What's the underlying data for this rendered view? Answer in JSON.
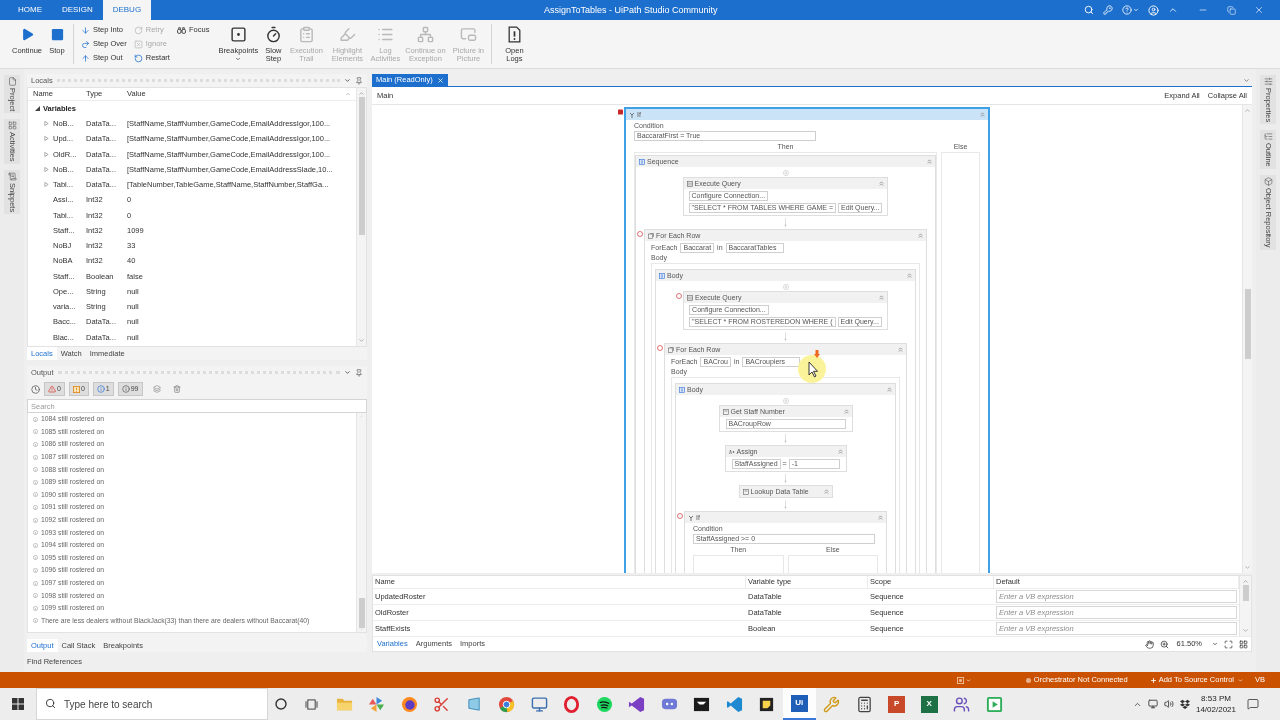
{
  "window": {
    "title": "AssignToTables - UiPath Studio Community"
  },
  "ribbon_tabs": [
    {
      "label": "HOME",
      "selected": false
    },
    {
      "label": "DESIGN",
      "selected": false
    },
    {
      "label": "DEBUG",
      "selected": true
    }
  ],
  "ribbon": {
    "groups": [
      {
        "items": [
          {
            "kind": "large",
            "label": "Continue",
            "disabled": false
          },
          {
            "kind": "large",
            "label": "Stop",
            "disabled": false
          }
        ]
      },
      {
        "items": [
          {
            "kind": "column",
            "buttons": [
              {
                "label": "Step Into",
                "disabled": false
              },
              {
                "label": "Step Over",
                "disabled": false
              },
              {
                "label": "Step Out",
                "disabled": false
              }
            ]
          },
          {
            "kind": "column",
            "buttons": [
              {
                "label": "Retry",
                "disabled": true
              },
              {
                "label": "Ignore",
                "disabled": true
              },
              {
                "label": "Restart",
                "disabled": false
              }
            ]
          },
          {
            "kind": "column",
            "buttons": [
              {
                "label": "Focus",
                "disabled": false
              }
            ]
          },
          {
            "kind": "large",
            "label": "Breakpoints",
            "disabled": false,
            "dropdown": true
          },
          {
            "kind": "large",
            "label": "Slow Step",
            "disabled": false
          },
          {
            "kind": "large",
            "label": "Execution Trail",
            "disabled": true
          },
          {
            "kind": "large",
            "label": "Highlight Elements",
            "disabled": true
          },
          {
            "kind": "large",
            "label": "Log Activities",
            "disabled": true
          },
          {
            "kind": "large",
            "label": "Continue on Exception",
            "disabled": true
          },
          {
            "kind": "large",
            "label": "Picture in Picture",
            "disabled": true
          }
        ]
      },
      {
        "items": [
          {
            "kind": "large",
            "label": "Open Logs",
            "disabled": false
          }
        ]
      }
    ]
  },
  "left_dock": [
    {
      "label": "Project"
    },
    {
      "label": "Activities"
    },
    {
      "label": "Snippets"
    }
  ],
  "locals": {
    "title": "Locals",
    "columns": [
      "Name",
      "Type",
      "Value"
    ],
    "group": {
      "label": "Variables",
      "expanded": true
    },
    "rows": [
      {
        "name": "NoB...",
        "type": "DataTa...",
        "value": "[StaffName,StaffNumber,GameCode,EmailAddressIgor,100...",
        "expandable": true
      },
      {
        "name": "Upd...",
        "type": "DataTa...",
        "value": "[StaffName,StaffNumber,GameCode,EmailAddressIgor,100...",
        "expandable": true
      },
      {
        "name": "OldR...",
        "type": "DataTa...",
        "value": "[StaffName,StaffNumber,GameCode,EmailAddressIgor,100...",
        "expandable": true
      },
      {
        "name": "NoB...",
        "type": "DataTa...",
        "value": "[StaffName,StaffNumber,GameCode,EmailAddressSlade,10...",
        "expandable": true
      },
      {
        "name": "Tabl...",
        "type": "DataTa...",
        "value": "[TableNumber,TableGame,StaffName,StaffNumber,StaffGa...",
        "expandable": true
      },
      {
        "name": "Assi...",
        "type": "Int32",
        "value": "0",
        "expandable": false
      },
      {
        "name": "Tabl...",
        "type": "Int32",
        "value": "0",
        "expandable": false
      },
      {
        "name": "Staff...",
        "type": "Int32",
        "value": "1099",
        "expandable": false
      },
      {
        "name": "NoBJ",
        "type": "Int32",
        "value": "33",
        "expandable": false
      },
      {
        "name": "NoBA",
        "type": "Int32",
        "value": "40",
        "expandable": false
      },
      {
        "name": "Staff...",
        "type": "Boolean",
        "value": "false",
        "expandable": false
      },
      {
        "name": "Ope...",
        "type": "String",
        "value": "null",
        "expandable": false
      },
      {
        "name": "varia...",
        "type": "String",
        "value": "null",
        "expandable": false
      },
      {
        "name": "Bacc...",
        "type": "DataTa...",
        "value": "null",
        "expandable": false
      },
      {
        "name": "Blac...",
        "type": "DataTa...",
        "value": "null",
        "expandable": false
      }
    ],
    "tabs": [
      {
        "label": "Locals",
        "selected": true
      },
      {
        "label": "Watch",
        "selected": false
      },
      {
        "label": "Immediate",
        "selected": false
      }
    ]
  },
  "output": {
    "title": "Output",
    "filters": [
      {
        "kind": "error",
        "count": "0",
        "selected": true
      },
      {
        "kind": "warning",
        "count": "0",
        "selected": true
      },
      {
        "kind": "info",
        "count": "1",
        "selected": true
      },
      {
        "kind": "trace",
        "count": "99",
        "selected": true
      }
    ],
    "search": {
      "placeholder": "Search"
    },
    "lines": [
      "1084 still rostered on",
      "1085 still rostered on",
      "1086 still rostered on",
      "1087 still rostered on",
      "1088 still rostered on",
      "1089 still rostered on",
      "1090 still rostered on",
      "1091 still rostered on",
      "1092 still rostered on",
      "1093 still rostered on",
      "1094 still rostered on",
      "1095 still rostered on",
      "1096 still rostered on",
      "1097 still rostered on",
      "1098 still rostered on",
      "1099 still rostered on",
      "There are less dealers without BlackJack(33) than there are dealers without Baccarat(40)"
    ],
    "tabs": [
      {
        "label": "Output",
        "selected": true
      },
      {
        "label": "Call Stack",
        "selected": false
      },
      {
        "label": "Breakpoints",
        "selected": false
      }
    ]
  },
  "find_references": {
    "label": "Find References"
  },
  "document_tabs": [
    {
      "label": "Main (ReadOnly)",
      "selected": true
    }
  ],
  "designer": {
    "breadcrumb": "Main",
    "expand_all": "Expand All",
    "collapse_all": "Collapse All",
    "root": {
      "kind": "if",
      "title": "If",
      "selected": true,
      "breakpoint": true,
      "breakpoint_active": true,
      "condition_label": "Condition",
      "condition": "BaccaratFirst = True",
      "then_label": "Then",
      "else_label": "Else",
      "then": [
        {
          "kind": "sequence",
          "title": "Sequence",
          "selected": false,
          "children": [
            {
              "kind": "execute_query",
              "title": "Execute Query",
              "selected": false,
              "connection_button": "Configure Connection...",
              "query": "\"SELECT * FROM TABLES WHERE GAME =",
              "edit_button": "Edit Query..."
            },
            {
              "kind": "for_each_row",
              "title": "For Each Row",
              "selected": false,
              "breakpoint": true,
              "breakpoint_active": false,
              "foreach_label": "ForEach",
              "item": "Baccarat",
              "in_label": "in",
              "collection": "BaccaratTables",
              "body_label": "Body",
              "body": [
                {
                  "kind": "sequence",
                  "title": "Body",
                  "selected": false,
                  "children": [
                    {
                      "kind": "execute_query",
                      "title": "Execute Query",
                      "selected": false,
                      "breakpoint": true,
                      "breakpoint_active": false,
                      "connection_button": "Configure Connection...",
                      "query": "\"SELECT * FROM ROSTEREDON WHERE (",
                      "edit_button": "Edit Query..."
                    },
                    {
                      "kind": "for_each_row",
                      "title": "For Each Row",
                      "selected": false,
                      "breakpoint": true,
                      "breakpoint_active": false,
                      "foreach_label": "ForEach",
                      "item": "BACrou",
                      "in_label": "in",
                      "collection": "BACroupiers",
                      "body_label": "Body",
                      "body": [
                        {
                          "kind": "sequence",
                          "title": "Body",
                          "selected": false,
                          "children": [
                            {
                              "kind": "invoke",
                              "title": "Get Staff Number",
                              "selected": false,
                              "argument": "BACroupRow"
                            },
                            {
                              "kind": "assign",
                              "title": "Assign",
                              "selected": false,
                              "to": "StaffAssigned",
                              "operator": "=",
                              "value": "-1"
                            },
                            {
                              "kind": "collapsed",
                              "title": "Lookup Data Table",
                              "selected": false
                            },
                            {
                              "kind": "if",
                              "title": "If",
                              "selected": false,
                              "breakpoint": true,
                              "breakpoint_active": false,
                              "condition_label": "Condition",
                              "condition": "StaffAssigned >= 0",
                              "then_label": "Then",
                              "else_label": "Else"
                            }
                          ]
                        }
                      ]
                    }
                  ]
                }
              ]
            }
          ]
        }
      ]
    }
  },
  "variables_panel": {
    "columns": [
      "Name",
      "Variable type",
      "Scope",
      "Default"
    ],
    "rows": [
      {
        "name": "UpdatedRoster",
        "type": "DataTable",
        "scope": "Sequence",
        "default": {
          "placeholder": "Enter a VB expression"
        }
      },
      {
        "name": "OldRoster",
        "type": "DataTable",
        "scope": "Sequence",
        "default": {
          "placeholder": "Enter a VB expression"
        }
      },
      {
        "name": "StaffExists",
        "type": "Boolean",
        "scope": "Sequence",
        "default": {
          "placeholder": "Enter a VB expression"
        }
      }
    ],
    "tabs": [
      {
        "label": "Variables",
        "selected": true
      },
      {
        "label": "Arguments",
        "selected": false
      },
      {
        "label": "Imports",
        "selected": false
      }
    ],
    "zoom": "61.50%"
  },
  "right_dock": [
    {
      "label": "Properties"
    },
    {
      "label": "Outline"
    },
    {
      "label": "Object Repository"
    }
  ],
  "status_bar": {
    "orchestrator": "Orchestrator Not Connected",
    "source_control": "Add To Source Control",
    "language": "VB"
  },
  "taskbar": {
    "search": {
      "placeholder": "Type here to search"
    },
    "apps": [
      {
        "kind": "folder",
        "selected": false
      },
      {
        "kind": "pinwheel",
        "selected": false
      },
      {
        "kind": "globe",
        "selected": false
      },
      {
        "kind": "scissors",
        "selected": false
      },
      {
        "kind": "window",
        "selected": false
      },
      {
        "kind": "round-logo",
        "selected": false
      },
      {
        "kind": "monitor",
        "selected": false
      },
      {
        "kind": "ring",
        "selected": false
      },
      {
        "kind": "disc",
        "selected": false
      },
      {
        "kind": "angled-logo",
        "selected": false
      },
      {
        "kind": "chat",
        "selected": false
      },
      {
        "kind": "tile",
        "selected": false
      },
      {
        "kind": "code",
        "selected": false
      },
      {
        "kind": "note",
        "selected": false
      },
      {
        "kind": "label-tile",
        "label": "Ui",
        "color": "#1f5fb8",
        "selected": true
      },
      {
        "kind": "tools",
        "selected": false
      },
      {
        "kind": "calculator",
        "selected": false
      },
      {
        "kind": "label-tile",
        "label": "P",
        "color": "#c8482a",
        "selected": false
      },
      {
        "kind": "label-tile",
        "label": "X",
        "color": "#1e7145",
        "selected": false
      },
      {
        "kind": "people",
        "selected": false
      },
      {
        "kind": "play",
        "selected": false
      }
    ],
    "time": "8:53 PM",
    "date": "14/02/2021"
  }
}
